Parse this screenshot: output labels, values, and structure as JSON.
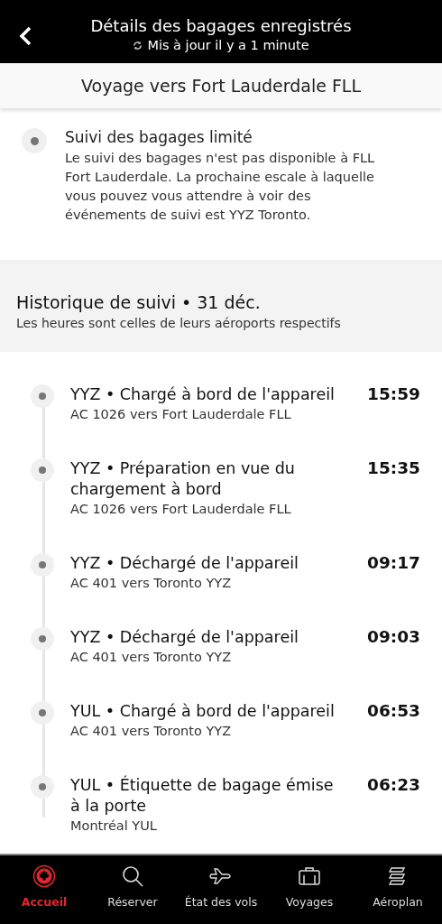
{
  "header": {
    "title": "Détails des bagages enregistrés",
    "updated": "Mis à jour il y a 1 minute"
  },
  "trip": {
    "title": "Voyage vers Fort Lauderdale FLL"
  },
  "notice": {
    "title": "Suivi des bagages limité",
    "text": "Le suivi des bagages n'est pas disponible à FLL Fort Lauderdale. La prochaine escale à laquelle vous pouvez vous attendre à voir des événements de suivi est YYZ Toronto."
  },
  "history": {
    "title": "Historique de suivi • 31 déc.",
    "subtitle": "Les heures sont celles de leurs aéroports respectifs"
  },
  "events": [
    {
      "title": "YYZ • Chargé à bord de l'appareil",
      "detail": "AC 1026 vers Fort Lauderdale FLL",
      "time": "15:59"
    },
    {
      "title": "YYZ • Préparation en vue du chargement à bord",
      "detail": "AC 1026 vers Fort Lauderdale FLL",
      "time": "15:35"
    },
    {
      "title": "YYZ • Déchargé de l'appareil",
      "detail": "AC 401 vers Toronto YYZ",
      "time": "09:17"
    },
    {
      "title": "YYZ • Déchargé de l'appareil",
      "detail": "AC 401 vers Toronto YYZ",
      "time": "09:03"
    },
    {
      "title": "YUL • Chargé à bord de l'appareil",
      "detail": "AC 401 vers Toronto YYZ",
      "time": "06:53"
    },
    {
      "title": "YUL • Étiquette de bagage émise à la porte",
      "detail": "Montréal YUL",
      "time": "06:23"
    }
  ],
  "nav": [
    {
      "kind": "home",
      "label": "Accueil",
      "selected": true
    },
    {
      "kind": "search",
      "label": "Réserver",
      "selected": false
    },
    {
      "kind": "plane",
      "label": "État des vols",
      "selected": false
    },
    {
      "kind": "bag",
      "label": "Voyages",
      "selected": false
    },
    {
      "kind": "loyalty",
      "label": "Aéroplan",
      "selected": false
    }
  ]
}
